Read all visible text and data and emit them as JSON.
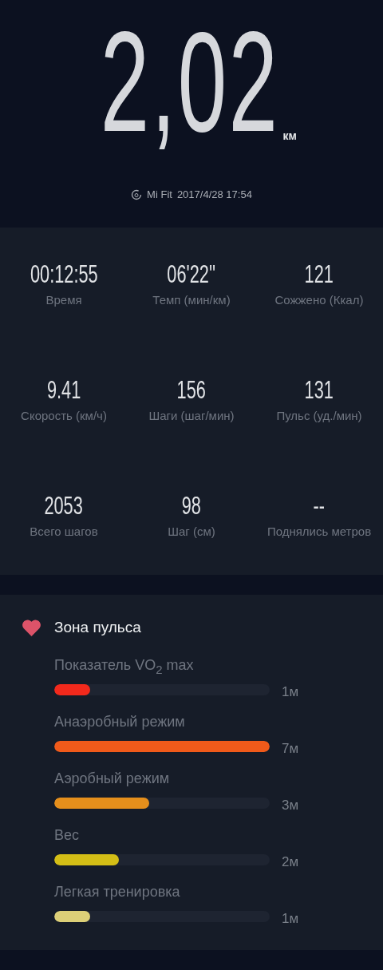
{
  "distance": {
    "value": "2,02",
    "unit": "км"
  },
  "source": {
    "app": "Mi Fit",
    "datetime": "2017/4/28 17:54"
  },
  "stats": [
    {
      "value": "00:12:55",
      "label": "Время"
    },
    {
      "value": "06'22''",
      "label": "Темп (мин/км)"
    },
    {
      "value": "121",
      "label": "Сожжено (Ккал)"
    },
    {
      "value": "9.41",
      "label": "Скорость (км/ч)"
    },
    {
      "value": "156",
      "label": "Шаги (шаг/мин)"
    },
    {
      "value": "131",
      "label": "Пульс (уд./мин)"
    },
    {
      "value": "2053",
      "label": "Всего шагов"
    },
    {
      "value": "98",
      "label": "Шаг (см)"
    },
    {
      "value": "--",
      "label": "Поднялись метров"
    }
  ],
  "heart_zone": {
    "title": "Зона пульса",
    "zones": [
      {
        "label": "Показатель VO$_{2}$ max",
        "level": 0.165,
        "color": "#f2291c",
        "duration": "1м"
      },
      {
        "label": "Анаэробный режим",
        "level": 1.0,
        "color": "#f05a1a",
        "duration": "7м"
      },
      {
        "label": "Аэробный режим",
        "level": 0.44,
        "color": "#e58f1c",
        "duration": "3м"
      },
      {
        "label": "Вес",
        "level": 0.3,
        "color": "#d4be16",
        "duration": "2м"
      },
      {
        "label": "Легкая тренировка",
        "level": 0.165,
        "color": "#dccf78",
        "duration": "1м"
      }
    ]
  }
}
